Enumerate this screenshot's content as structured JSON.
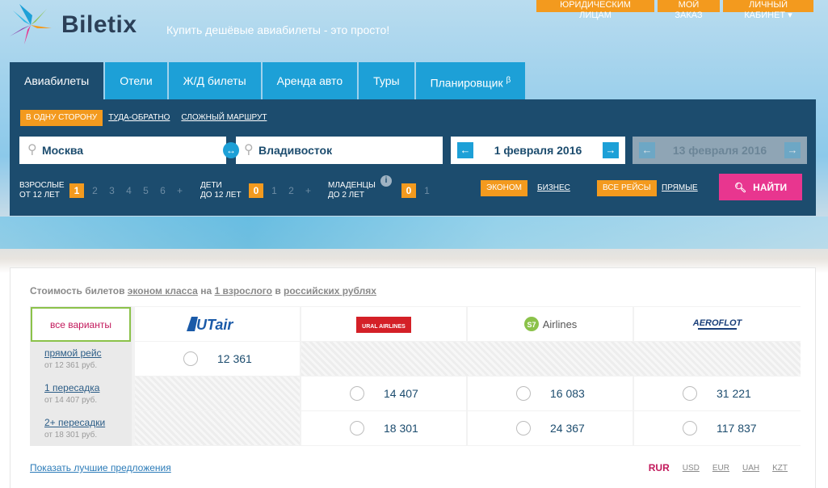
{
  "brand": {
    "name": "Biletix",
    "tagline": "Купить дешёвые авиабилеты - это просто!"
  },
  "top_links": {
    "corporate": "ЮРИДИЧЕСКИМ ЛИЦАМ",
    "my_order": "МОЙ ЗАКАЗ",
    "cabinet": "ЛИЧНЫЙ КАБИНЕТ"
  },
  "tabs": [
    {
      "label": "Авиабилеты"
    },
    {
      "label": "Отели"
    },
    {
      "label": "Ж/Д билеты"
    },
    {
      "label": "Аренда авто"
    },
    {
      "label": "Туры"
    },
    {
      "label": "Планировщик",
      "badge": "β"
    }
  ],
  "search": {
    "trip_types": [
      "В ОДНУ СТОРОНУ",
      "ТУДА-ОБРАТНО",
      "СЛОЖНЫЙ МАРШРУТ"
    ],
    "from": "Москва",
    "to": "Владивосток",
    "date_depart": "1 февраля 2016",
    "date_return": "13 февраля 2016",
    "adults_label_1": "ВЗРОСЛЫЕ",
    "adults_label_2": "ОТ 12 ЛЕТ",
    "adults": [
      "1",
      "2",
      "3",
      "4",
      "5",
      "6",
      "+"
    ],
    "children_label_1": "ДЕТИ",
    "children_label_2": "ДО 12 ЛЕТ",
    "children": [
      "0",
      "1",
      "2",
      "+"
    ],
    "infants_label_1": "МЛАДЕНЦЫ",
    "infants_label_2": "ДО 2 ЛЕТ",
    "infants": [
      "0",
      "1"
    ],
    "class_economy": "ЭКОНОМ",
    "class_business": "БИЗНЕС",
    "flights_all": "ВСЕ РЕЙСЫ",
    "flights_direct": "ПРЯМЫЕ",
    "search_button": "НАЙТИ"
  },
  "results": {
    "note_1": "Стоимость билетов",
    "note_class": "эконом класса",
    "note_2": "на",
    "note_pax": "1 взрослого",
    "note_3": "в",
    "note_currency": "российских рублях",
    "all_variants": "все варианты",
    "stops": [
      {
        "label": "прямой рейс",
        "min": "от 12 361 руб."
      },
      {
        "label": "1 пересадка",
        "min": "от 14 407 руб."
      },
      {
        "label": "2+ пересадки",
        "min": "от 18 301 руб."
      }
    ],
    "airlines": [
      "UTair",
      "URAL AIRLINES",
      "Airlines",
      "AEROFLOT"
    ],
    "prices": {
      "direct_utair": "12 361",
      "one_ural": "14 407",
      "one_s7": "16 083",
      "one_aeroflot": "31 221",
      "two_ural": "18 301",
      "two_s7": "24 367",
      "two_aeroflot": "117 837"
    },
    "best_offers": "Показать лучшие предложения",
    "currencies": [
      "RUR",
      "USD",
      "EUR",
      "UAH",
      "KZT"
    ]
  },
  "colors": {
    "dark": "#1c4c6e",
    "blue": "#1da0d7",
    "orange": "#f39a1e",
    "pink": "#e8368f"
  }
}
